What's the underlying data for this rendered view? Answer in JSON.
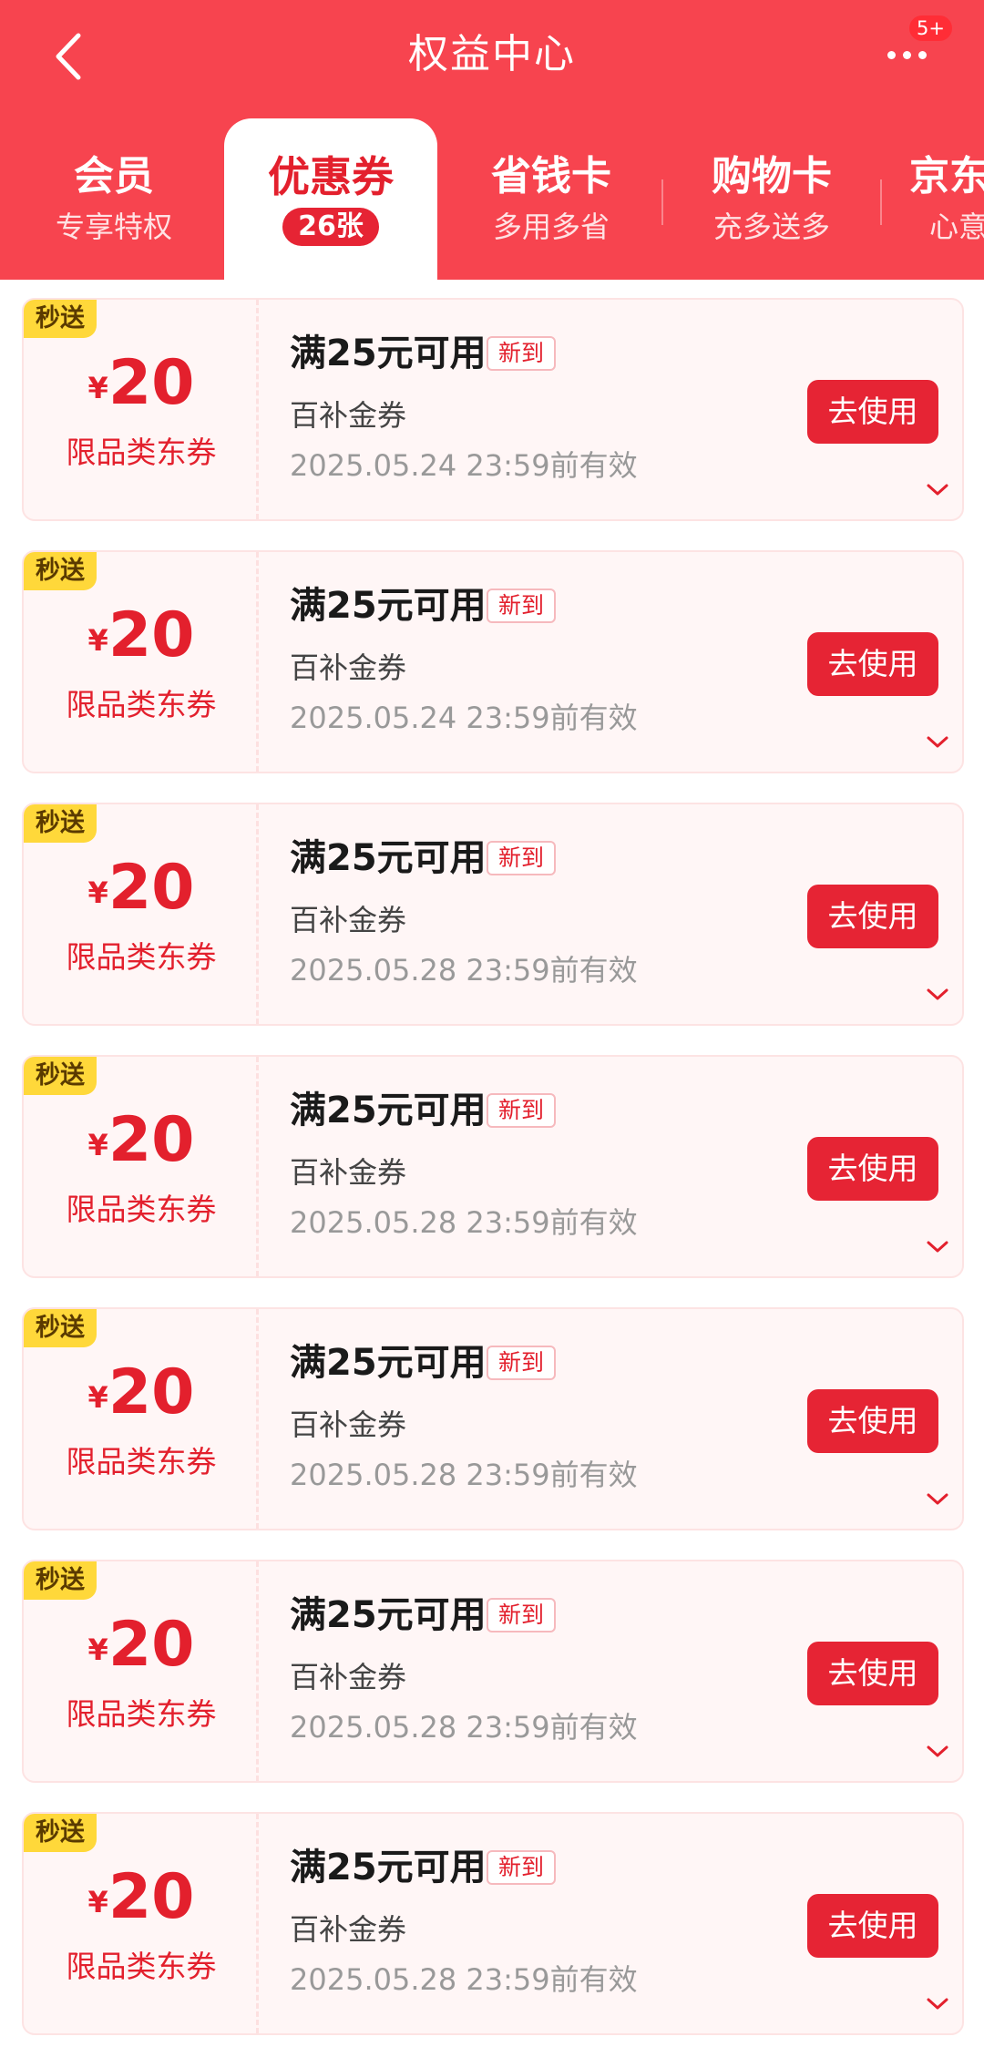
{
  "header": {
    "title": "权益中心",
    "notification_badge": "5+",
    "background_color": "#f7444f"
  },
  "tabs": [
    {
      "label": "会员",
      "sub": "专享特权",
      "active": false
    },
    {
      "label": "优惠券",
      "sub": "26张",
      "active": true
    },
    {
      "label": "省钱卡",
      "sub": "多用多省",
      "active": false
    },
    {
      "label": "购物卡",
      "sub": "充多送多",
      "active": false
    },
    {
      "label": "京东",
      "sub": "心意",
      "active": false
    }
  ],
  "accent_color": "#e3202d",
  "coupons": [
    {
      "tag": "秒送",
      "currency": "¥",
      "amount": "20",
      "scope": "限品类东券",
      "title": "满25元可用",
      "new_label": "新到",
      "subtitle": "百补金券",
      "expiry": "2025.05.24 23:59前有效",
      "button": "去使用"
    },
    {
      "tag": "秒送",
      "currency": "¥",
      "amount": "20",
      "scope": "限品类东券",
      "title": "满25元可用",
      "new_label": "新到",
      "subtitle": "百补金券",
      "expiry": "2025.05.24 23:59前有效",
      "button": "去使用"
    },
    {
      "tag": "秒送",
      "currency": "¥",
      "amount": "20",
      "scope": "限品类东券",
      "title": "满25元可用",
      "new_label": "新到",
      "subtitle": "百补金券",
      "expiry": "2025.05.28 23:59前有效",
      "button": "去使用"
    },
    {
      "tag": "秒送",
      "currency": "¥",
      "amount": "20",
      "scope": "限品类东券",
      "title": "满25元可用",
      "new_label": "新到",
      "subtitle": "百补金券",
      "expiry": "2025.05.28 23:59前有效",
      "button": "去使用"
    },
    {
      "tag": "秒送",
      "currency": "¥",
      "amount": "20",
      "scope": "限品类东券",
      "title": "满25元可用",
      "new_label": "新到",
      "subtitle": "百补金券",
      "expiry": "2025.05.28 23:59前有效",
      "button": "去使用"
    },
    {
      "tag": "秒送",
      "currency": "¥",
      "amount": "20",
      "scope": "限品类东券",
      "title": "满25元可用",
      "new_label": "新到",
      "subtitle": "百补金券",
      "expiry": "2025.05.28 23:59前有效",
      "button": "去使用"
    },
    {
      "tag": "秒送",
      "currency": "¥",
      "amount": "20",
      "scope": "限品类东券",
      "title": "满25元可用",
      "new_label": "新到",
      "subtitle": "百补金券",
      "expiry": "2025.05.28 23:59前有效",
      "button": "去使用"
    }
  ]
}
